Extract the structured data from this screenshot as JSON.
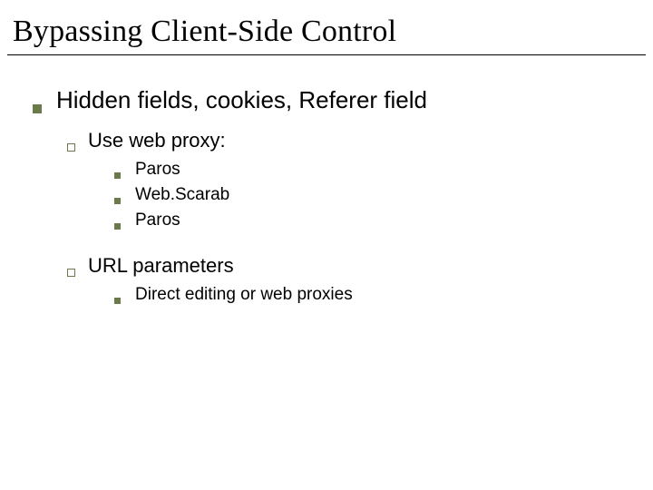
{
  "title": "Bypassing Client-Side Control",
  "l1_item": "Hidden fields, cookies, Referer field",
  "l2": {
    "a": "Use web proxy:",
    "b": "URL parameters"
  },
  "l3a": {
    "0": "Paros",
    "1": "Web.Scarab",
    "2": "Paros"
  },
  "l3b": {
    "0": "Direct editing or web proxies"
  }
}
